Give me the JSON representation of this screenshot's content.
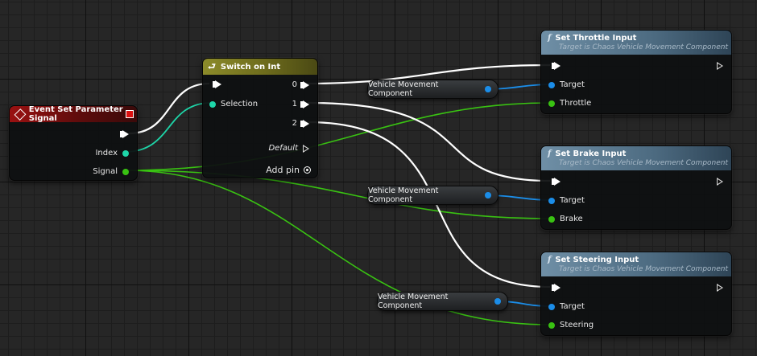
{
  "event_node": {
    "title": "Event Set Parameter Signal",
    "pins": {
      "index": "Index",
      "signal": "Signal"
    }
  },
  "switch_node": {
    "title": "Switch on Int",
    "pins": {
      "selection": "Selection",
      "out0": "0",
      "out1": "1",
      "out2": "2",
      "default": "Default",
      "add_pin": "Add pin"
    }
  },
  "var_nodes": [
    {
      "label": "Vehicle Movement Component"
    },
    {
      "label": "Vehicle Movement Component"
    },
    {
      "label": "Vehicle Movement Component"
    }
  ],
  "func_nodes": [
    {
      "title": "Set Throttle Input",
      "subtitle": "Target is Chaos Vehicle Movement Component",
      "pin_target": "Target",
      "pin_value": "Throttle"
    },
    {
      "title": "Set Brake Input",
      "subtitle": "Target is Chaos Vehicle Movement Component",
      "pin_target": "Target",
      "pin_value": "Brake"
    },
    {
      "title": "Set Steering Input",
      "subtitle": "Target is Chaos Vehicle Movement Component",
      "pin_target": "Target",
      "pin_value": "Steering"
    }
  ],
  "icons": {
    "event": "event-diamond-icon",
    "switch": "switch-icon",
    "function": "function-icon",
    "add_pin": "add-pin-icon",
    "close": "close-icon"
  },
  "colors": {
    "exec_wire": "#ffffff",
    "int_wire": "#1ed6a9",
    "float_wire": "#39c212",
    "object_wire": "#1b8de8"
  }
}
